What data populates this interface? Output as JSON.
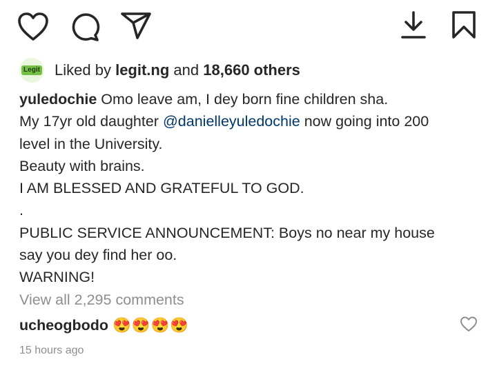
{
  "post_actions": {
    "like": "heart-icon",
    "comment": "comment-icon",
    "share": "send-icon",
    "download": "download-icon",
    "save": "bookmark-icon"
  },
  "likes": {
    "avatar_logo_text": "Legit",
    "prefix": "Liked by",
    "user": "legit.ng",
    "conjunction": "and",
    "others": "18,660 others"
  },
  "caption": {
    "username": "yuledochie",
    "first_line": "Omo leave am, I dey born fine children sha.",
    "line2_before": "My 17yr old daughter",
    "mention": "@danielleyuledochie",
    "line2_after": "now going into 200",
    "line3": "level in the University.",
    "line4": "Beauty with brains.",
    "line5": "I AM BLESSED AND GRATEFUL TO GOD.",
    "line6": ".",
    "line7": "PUBLIC SERVICE ANNOUNCEMENT: Boys no near my house",
    "line8": "say you dey find her oo.",
    "line9": "WARNING!"
  },
  "view_all_comments": "View all 2,295 comments",
  "top_comment": {
    "username": "ucheogbodo",
    "emojis": [
      "😍",
      "😍",
      "😍",
      "😍"
    ]
  },
  "timestamp": "15 hours ago",
  "colors": {
    "text": "#262626",
    "secondary": "#8e8e8e",
    "mention": "#00376b",
    "brand_green": "#74c044"
  }
}
